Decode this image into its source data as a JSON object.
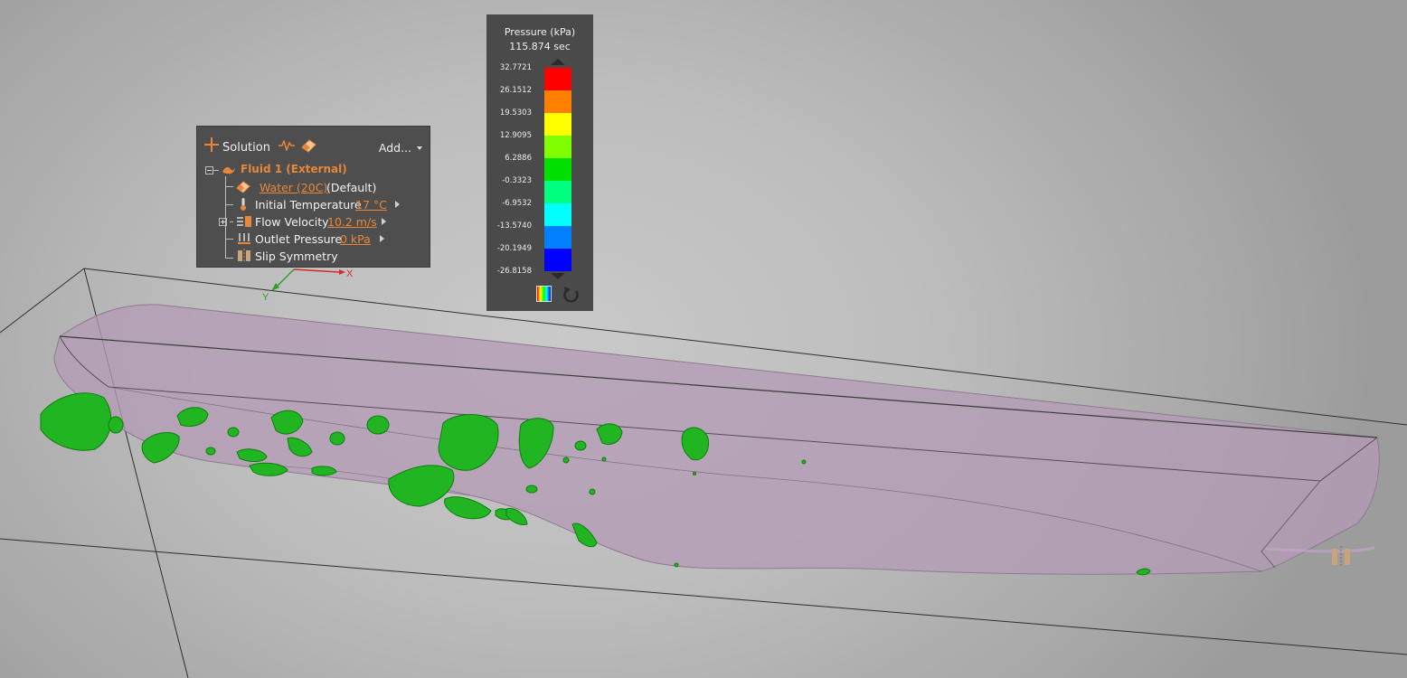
{
  "tree": {
    "solution_label": "Solution",
    "add_label": "Add...",
    "fluid_label": "Fluid 1 (External)",
    "material_link": "Water (20C)",
    "material_suffix": "(Default)",
    "initial_temperature_label": "Initial Temperature",
    "initial_temperature_value": "17 °C",
    "flow_velocity_label": "Flow Velocity",
    "flow_velocity_value": "10.2 m/s",
    "outlet_pressure_label": "Outlet Pressure",
    "outlet_pressure_value": "0 kPa",
    "slip_symmetry_label": "Slip Symmetry"
  },
  "legend": {
    "title": "Pressure (kPa)",
    "time": "115.874 sec",
    "values": [
      "32.7721",
      "26.1512",
      "19.5303",
      "12.9095",
      "6.2886",
      "-0.3323",
      "-6.9532",
      "-13.5740",
      "-20.1949",
      "-26.8158"
    ],
    "colors": [
      "#ff0000",
      "#ff8000",
      "#ffff00",
      "#80ff00",
      "#00e000",
      "#00ff80",
      "#00ffff",
      "#0080ff",
      "#0000ff"
    ]
  },
  "axes": {
    "x": "X",
    "y": "Y"
  },
  "colors": {
    "accent": "#e8873a",
    "panel_bg": "#4e4e4e",
    "hull_fill": "#b39bb5",
    "iso_surface": "#1fae1f"
  }
}
